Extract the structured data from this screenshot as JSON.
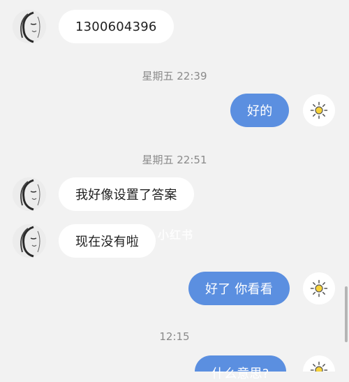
{
  "messages": {
    "m1": {
      "text": "1300604396"
    },
    "t1": {
      "text": "星期五 22:39"
    },
    "m2": {
      "text": "好的"
    },
    "t2": {
      "text": "星期五 22:51"
    },
    "m3": {
      "text": "我好像设置了答案"
    },
    "m4": {
      "text": "现在没有啦"
    },
    "m5": {
      "text": "好了 你看看"
    },
    "t3": {
      "text": "12:15"
    },
    "m6": {
      "text": "什么意思?"
    }
  },
  "watermark": {
    "text": "小红书"
  },
  "icons": {
    "contact_avatar": "sketch-portrait-avatar",
    "self_avatar": "sun-icon"
  },
  "colors": {
    "background": "#f2f2f2",
    "incoming_bubble": "#ffffff",
    "outgoing_bubble": "#5b8fe0",
    "timestamp": "#8a8a8a"
  }
}
